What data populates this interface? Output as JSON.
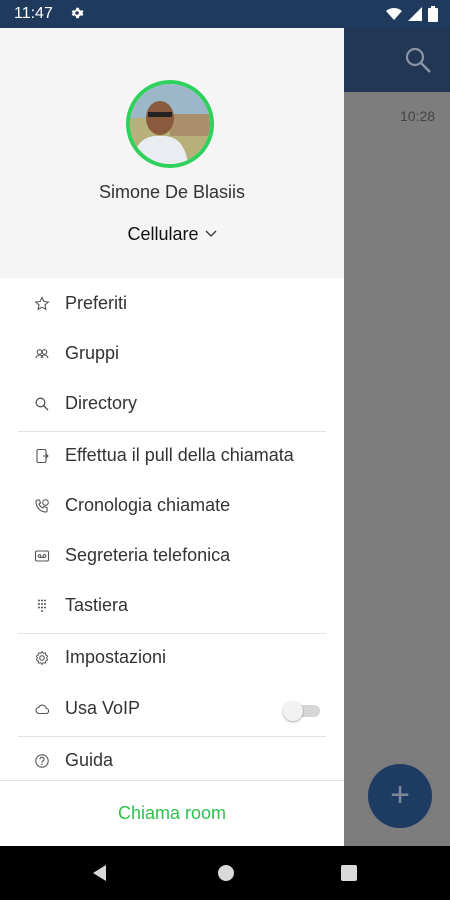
{
  "status_bar": {
    "time": "11:47"
  },
  "background_app": {
    "timestamp": "10:28",
    "fab_label": "+"
  },
  "drawer": {
    "user_name": "Simone De Blasiis",
    "phone_mode": "Cellulare",
    "menu_items": [
      {
        "label": "Preferiti",
        "icon": "star-icon"
      },
      {
        "label": "Gruppi",
        "icon": "group-icon"
      },
      {
        "label": "Directory",
        "icon": "search-icon"
      },
      {
        "label": "Effettua il pull della chiamata",
        "icon": "call-pull-icon"
      },
      {
        "label": "Cronologia chiamate",
        "icon": "call-history-icon"
      },
      {
        "label": "Segreteria telefonica",
        "icon": "voicemail-icon"
      },
      {
        "label": "Tastiera",
        "icon": "dialpad-icon"
      },
      {
        "label": "Impostazioni",
        "icon": "gear-icon"
      },
      {
        "label": "Usa VoIP",
        "icon": "cloud-icon"
      },
      {
        "label": "Guida",
        "icon": "help-icon"
      }
    ],
    "voip_enabled": false,
    "footer_button": "Chiama room"
  },
  "colors": {
    "accent": "#2ec24e",
    "app_bar": "#223754",
    "status_bar": "#1f3a5c"
  }
}
